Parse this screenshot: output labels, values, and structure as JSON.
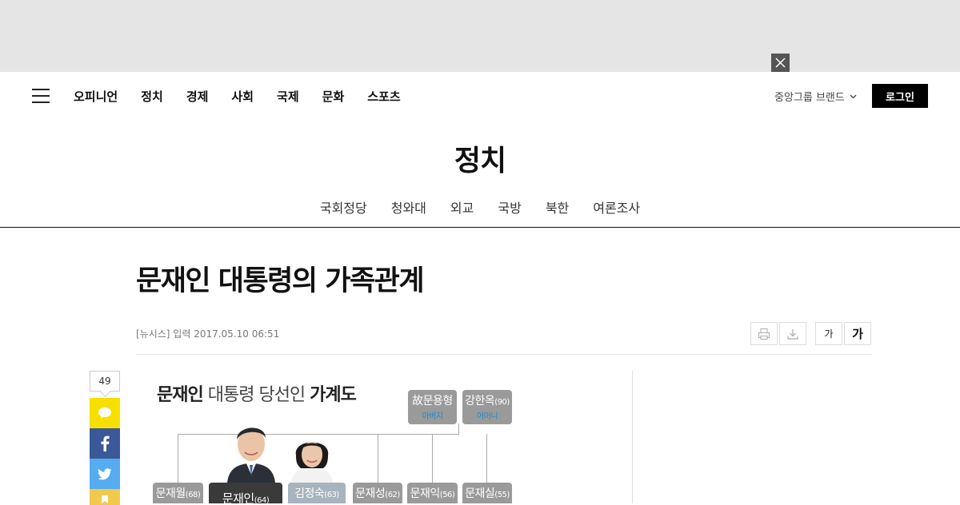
{
  "ad": {
    "close_icon": "close-icon"
  },
  "header": {
    "menu_icon": "hamburger-icon",
    "nav": [
      "오피니언",
      "정치",
      "경제",
      "사회",
      "국제",
      "문화",
      "스포츠"
    ],
    "brand_label": "중앙그룹 브랜드",
    "login_label": "로그인"
  },
  "section": {
    "title": "정치",
    "subnav": [
      "국회정당",
      "청와대",
      "외교",
      "국방",
      "북한",
      "여론조사"
    ]
  },
  "article": {
    "headline": "문재인 대통령의 가족관계",
    "byline": "[뉴시스] 입력 2017.05.10 06:51",
    "tools": {
      "font_small": "가",
      "font_large": "가"
    }
  },
  "share": {
    "count": "49"
  },
  "family_tree": {
    "title_name": "문재인",
    "title_mid": "대통령 당선인",
    "title_end": "가계도",
    "father_name": "故문용형",
    "father_rel": "아버지",
    "mother_name": "강한옥",
    "mother_age": "(90)",
    "mother_rel": "어머니",
    "members": [
      {
        "name": "문재월",
        "age": "(68)"
      },
      {
        "name": "문재인",
        "age": "(64)"
      },
      {
        "name": "김정숙",
        "age": "(63)"
      },
      {
        "name": "문재성",
        "age": "(62)"
      },
      {
        "name": "문재익",
        "age": "(56)"
      },
      {
        "name": "문재실",
        "age": "(55)"
      }
    ]
  },
  "colors": {
    "accent_black": "#000000",
    "kakao": "#f7e000",
    "facebook": "#3b5998",
    "twitter": "#55acee"
  }
}
